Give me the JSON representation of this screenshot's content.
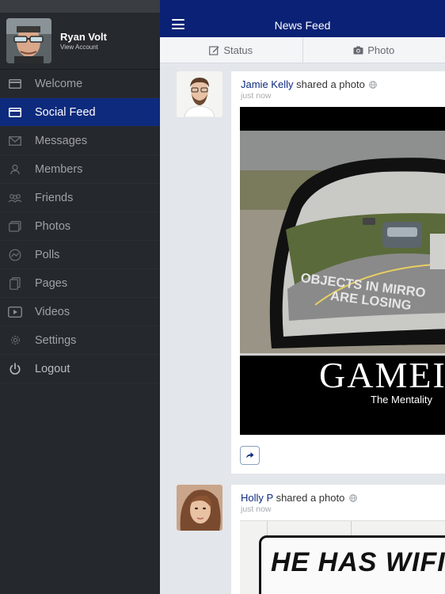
{
  "profile": {
    "name": "Ryan Volt",
    "subtitle": "View Account"
  },
  "menu": [
    {
      "label": "Welcome",
      "icon": "card-icon"
    },
    {
      "label": "Social Feed",
      "icon": "card-icon",
      "active": true
    },
    {
      "label": "Messages",
      "icon": "envelope-icon"
    },
    {
      "label": "Members",
      "icon": "member-icon"
    },
    {
      "label": "Friends",
      "icon": "friends-icon"
    },
    {
      "label": "Photos",
      "icon": "photos-icon"
    },
    {
      "label": "Polls",
      "icon": "polls-icon"
    },
    {
      "label": "Pages",
      "icon": "pages-icon"
    },
    {
      "label": "Videos",
      "icon": "video-play-icon"
    },
    {
      "label": "Settings",
      "icon": "gear-icon"
    },
    {
      "label": "Logout",
      "icon": "power-icon"
    }
  ],
  "header": {
    "title": "News Feed"
  },
  "tabs": {
    "status": "Status",
    "photo": "Photo"
  },
  "posts": [
    {
      "author": "Jamie Kelly",
      "action": "shared a photo",
      "time": "just now",
      "image_caption_line1": "OBJECTS IN MIRRO",
      "image_caption_line2": "ARE LOSING",
      "image_title": "GAMEI",
      "image_subtitle": "The Mentality"
    },
    {
      "author": "Holly P",
      "action": "shared a photo",
      "time": "just now",
      "image_text": "HE HAS WIFI"
    }
  ],
  "colors": {
    "sidebar_bg": "#25282d",
    "active_item": "#0d2a7d",
    "header_bg": "#0b2176",
    "feed_bg": "#e3e6ea",
    "author_link": "#0d2a7d"
  }
}
